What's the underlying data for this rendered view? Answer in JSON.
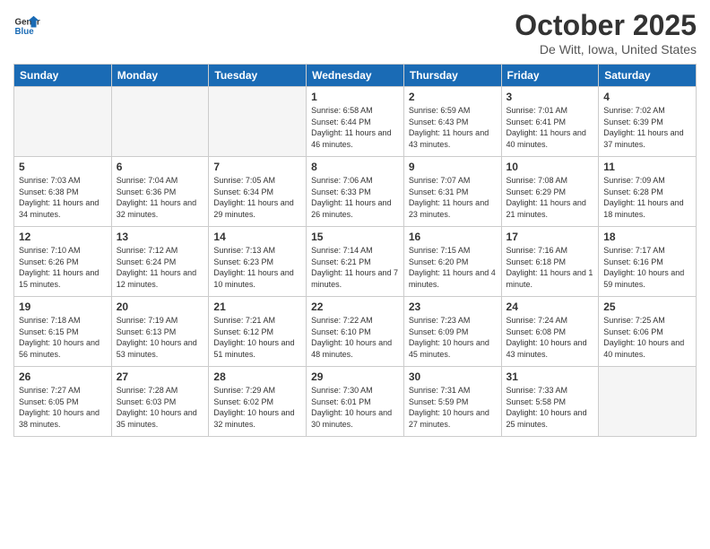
{
  "header": {
    "logo_line1": "General",
    "logo_line2": "Blue",
    "month_title": "October 2025",
    "location": "De Witt, Iowa, United States"
  },
  "days_of_week": [
    "Sunday",
    "Monday",
    "Tuesday",
    "Wednesday",
    "Thursday",
    "Friday",
    "Saturday"
  ],
  "weeks": [
    [
      {
        "day": "",
        "info": ""
      },
      {
        "day": "",
        "info": ""
      },
      {
        "day": "",
        "info": ""
      },
      {
        "day": "1",
        "info": "Sunrise: 6:58 AM\nSunset: 6:44 PM\nDaylight: 11 hours\nand 46 minutes."
      },
      {
        "day": "2",
        "info": "Sunrise: 6:59 AM\nSunset: 6:43 PM\nDaylight: 11 hours\nand 43 minutes."
      },
      {
        "day": "3",
        "info": "Sunrise: 7:01 AM\nSunset: 6:41 PM\nDaylight: 11 hours\nand 40 minutes."
      },
      {
        "day": "4",
        "info": "Sunrise: 7:02 AM\nSunset: 6:39 PM\nDaylight: 11 hours\nand 37 minutes."
      }
    ],
    [
      {
        "day": "5",
        "info": "Sunrise: 7:03 AM\nSunset: 6:38 PM\nDaylight: 11 hours\nand 34 minutes."
      },
      {
        "day": "6",
        "info": "Sunrise: 7:04 AM\nSunset: 6:36 PM\nDaylight: 11 hours\nand 32 minutes."
      },
      {
        "day": "7",
        "info": "Sunrise: 7:05 AM\nSunset: 6:34 PM\nDaylight: 11 hours\nand 29 minutes."
      },
      {
        "day": "8",
        "info": "Sunrise: 7:06 AM\nSunset: 6:33 PM\nDaylight: 11 hours\nand 26 minutes."
      },
      {
        "day": "9",
        "info": "Sunrise: 7:07 AM\nSunset: 6:31 PM\nDaylight: 11 hours\nand 23 minutes."
      },
      {
        "day": "10",
        "info": "Sunrise: 7:08 AM\nSunset: 6:29 PM\nDaylight: 11 hours\nand 21 minutes."
      },
      {
        "day": "11",
        "info": "Sunrise: 7:09 AM\nSunset: 6:28 PM\nDaylight: 11 hours\nand 18 minutes."
      }
    ],
    [
      {
        "day": "12",
        "info": "Sunrise: 7:10 AM\nSunset: 6:26 PM\nDaylight: 11 hours\nand 15 minutes."
      },
      {
        "day": "13",
        "info": "Sunrise: 7:12 AM\nSunset: 6:24 PM\nDaylight: 11 hours\nand 12 minutes."
      },
      {
        "day": "14",
        "info": "Sunrise: 7:13 AM\nSunset: 6:23 PM\nDaylight: 11 hours\nand 10 minutes."
      },
      {
        "day": "15",
        "info": "Sunrise: 7:14 AM\nSunset: 6:21 PM\nDaylight: 11 hours\nand 7 minutes."
      },
      {
        "day": "16",
        "info": "Sunrise: 7:15 AM\nSunset: 6:20 PM\nDaylight: 11 hours\nand 4 minutes."
      },
      {
        "day": "17",
        "info": "Sunrise: 7:16 AM\nSunset: 6:18 PM\nDaylight: 11 hours\nand 1 minute."
      },
      {
        "day": "18",
        "info": "Sunrise: 7:17 AM\nSunset: 6:16 PM\nDaylight: 10 hours\nand 59 minutes."
      }
    ],
    [
      {
        "day": "19",
        "info": "Sunrise: 7:18 AM\nSunset: 6:15 PM\nDaylight: 10 hours\nand 56 minutes."
      },
      {
        "day": "20",
        "info": "Sunrise: 7:19 AM\nSunset: 6:13 PM\nDaylight: 10 hours\nand 53 minutes."
      },
      {
        "day": "21",
        "info": "Sunrise: 7:21 AM\nSunset: 6:12 PM\nDaylight: 10 hours\nand 51 minutes."
      },
      {
        "day": "22",
        "info": "Sunrise: 7:22 AM\nSunset: 6:10 PM\nDaylight: 10 hours\nand 48 minutes."
      },
      {
        "day": "23",
        "info": "Sunrise: 7:23 AM\nSunset: 6:09 PM\nDaylight: 10 hours\nand 45 minutes."
      },
      {
        "day": "24",
        "info": "Sunrise: 7:24 AM\nSunset: 6:08 PM\nDaylight: 10 hours\nand 43 minutes."
      },
      {
        "day": "25",
        "info": "Sunrise: 7:25 AM\nSunset: 6:06 PM\nDaylight: 10 hours\nand 40 minutes."
      }
    ],
    [
      {
        "day": "26",
        "info": "Sunrise: 7:27 AM\nSunset: 6:05 PM\nDaylight: 10 hours\nand 38 minutes."
      },
      {
        "day": "27",
        "info": "Sunrise: 7:28 AM\nSunset: 6:03 PM\nDaylight: 10 hours\nand 35 minutes."
      },
      {
        "day": "28",
        "info": "Sunrise: 7:29 AM\nSunset: 6:02 PM\nDaylight: 10 hours\nand 32 minutes."
      },
      {
        "day": "29",
        "info": "Sunrise: 7:30 AM\nSunset: 6:01 PM\nDaylight: 10 hours\nand 30 minutes."
      },
      {
        "day": "30",
        "info": "Sunrise: 7:31 AM\nSunset: 5:59 PM\nDaylight: 10 hours\nand 27 minutes."
      },
      {
        "day": "31",
        "info": "Sunrise: 7:33 AM\nSunset: 5:58 PM\nDaylight: 10 hours\nand 25 minutes."
      },
      {
        "day": "",
        "info": ""
      }
    ]
  ]
}
